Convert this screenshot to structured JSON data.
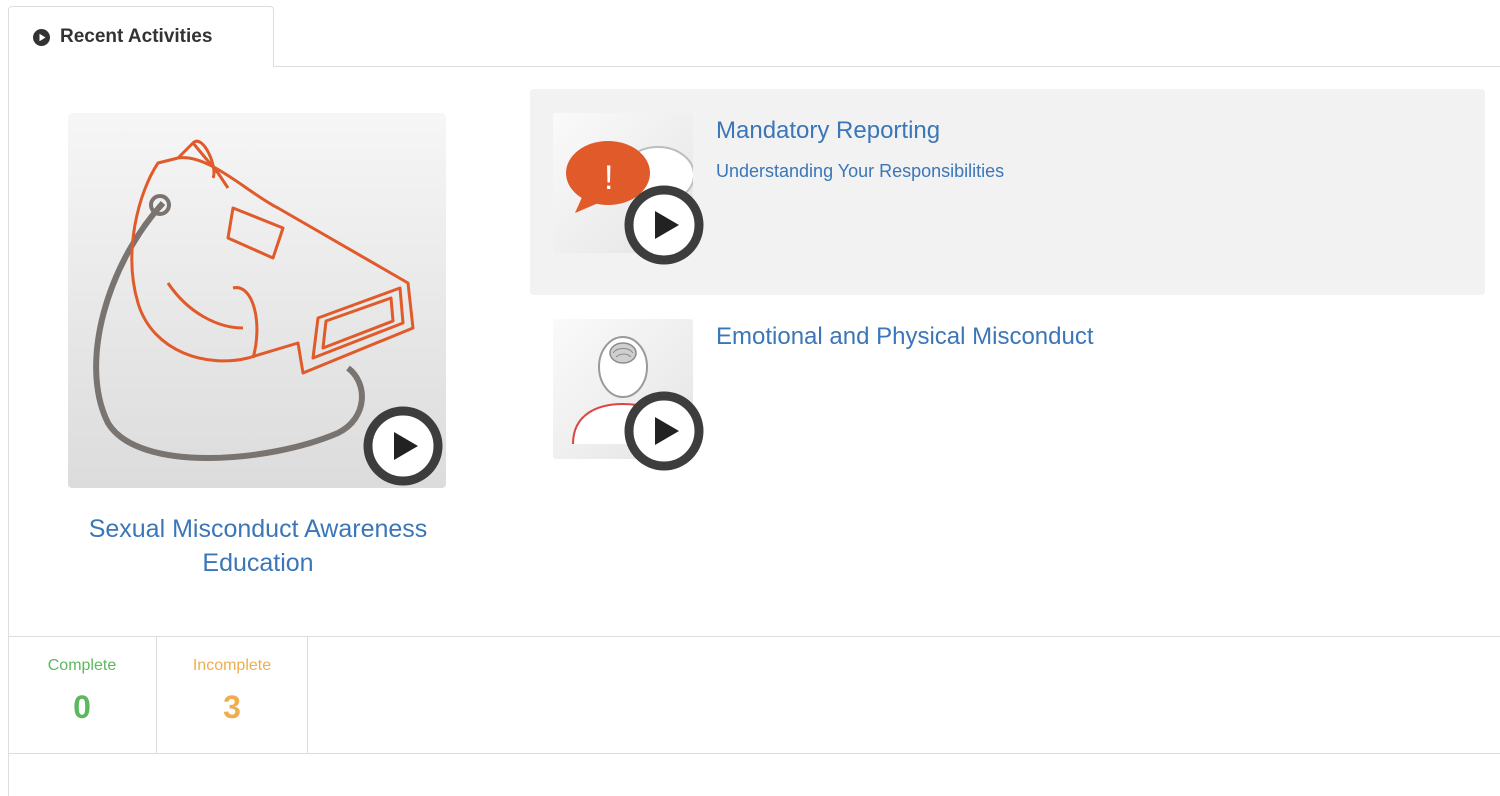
{
  "tab": {
    "label": "Recent Activities"
  },
  "featured": {
    "title": "Sexual Misconduct Awareness Education",
    "icon": "whistle-icon"
  },
  "activities": [
    {
      "title": "Mandatory Reporting",
      "subtitle": "Understanding Your Responsibilities",
      "icon": "speech-bubble-alert-icon",
      "active": true
    },
    {
      "title": "Emotional and Physical Misconduct",
      "subtitle": "",
      "icon": "person-brain-icon",
      "active": false
    }
  ],
  "stats": {
    "complete": {
      "label": "Complete",
      "value": "0",
      "color": "#5cb85c"
    },
    "incomplete": {
      "label": "Incomplete",
      "value": "3",
      "color": "#f0ad4e"
    }
  },
  "colors": {
    "link": "#3b76b8",
    "accent": "#e05a2a",
    "border": "#dddddd"
  }
}
